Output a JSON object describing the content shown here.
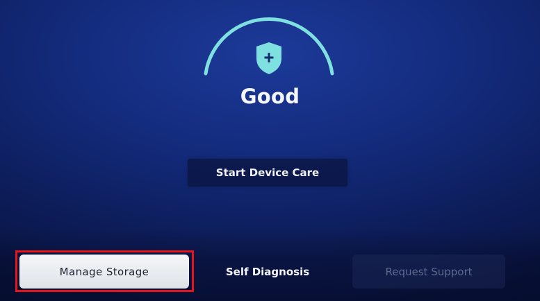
{
  "device_care": {
    "status": "Good",
    "start_button_label": "Start Device Care",
    "icon": "shield-plus-icon",
    "accent_color": "#7fe0e0"
  },
  "menu": {
    "manage_storage_label": "Manage Storage",
    "self_diagnosis_label": "Self Diagnosis",
    "request_support_label": "Request Support",
    "highlight_color": "#e6151c"
  }
}
